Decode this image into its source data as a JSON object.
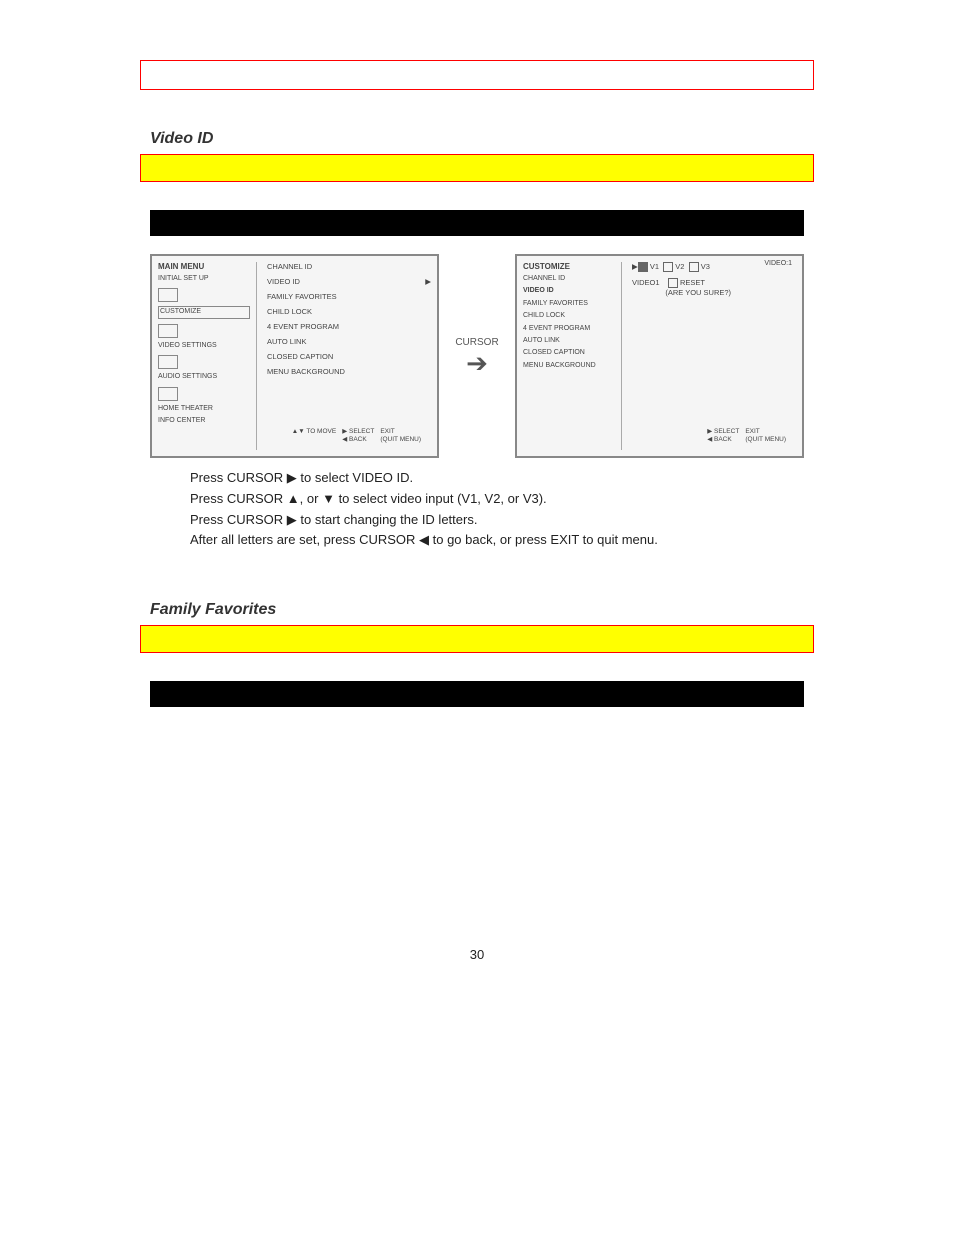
{
  "section1": {
    "title": "Video ID",
    "blackbar_label": "",
    "left_panel": {
      "header": "MAIN MENU",
      "items": [
        "INITIAL SET UP",
        "CUSTOMIZE",
        "VIDEO SETTINGS",
        "AUDIO SETTINGS",
        "HOME THEATER",
        "INFO CENTER"
      ],
      "right_items": [
        "CHANNEL ID",
        "VIDEO ID",
        "FAMILY FAVORITES",
        "CHILD LOCK",
        "4 EVENT PROGRAM",
        "AUTO LINK",
        "CLOSED CAPTION",
        "MENU BACKGROUND"
      ],
      "footer_move": "TO MOVE",
      "footer_select": "SELECT",
      "footer_back": "BACK",
      "footer_exit": "EXIT",
      "footer_quit": "(QUIT MENU)"
    },
    "cursor_label": "CURSOR",
    "right_panel": {
      "header": "CUSTOMIZE",
      "top_right": "VIDEO:1",
      "left_items": [
        "CHANNEL ID",
        "VIDEO ID",
        "FAMILY FAVORITES",
        "CHILD LOCK",
        "4 EVENT PROGRAM",
        "AUTO LINK",
        "CLOSED CAPTION",
        "MENU BACKGROUND"
      ],
      "v_row": "V1   V2   V3",
      "video_label": "VIDEO1",
      "reset_label": "RESET",
      "are_you_sure": "(ARE YOU SURE?)",
      "footer_select": "SELECT",
      "footer_back": "BACK",
      "footer_exit": "EXIT",
      "footer_quit": "(QUIT MENU)"
    },
    "instr1_a": "Press CURSOR ",
    "instr1_b": " to select VIDEO ID.",
    "instr2_a": "Press CURSOR ",
    "instr2_b": ", or ",
    "instr2_c": " to select video input (V1, V2, or V3).",
    "instr3_a": "Press CURSOR ",
    "instr3_b": " to start changing the ID letters.",
    "instr4_a": "After all letters are set, press CURSOR ",
    "instr4_b": " to go back, or press EXIT to quit menu."
  },
  "section2": {
    "title": "Family Favorites"
  },
  "page_number": "30"
}
